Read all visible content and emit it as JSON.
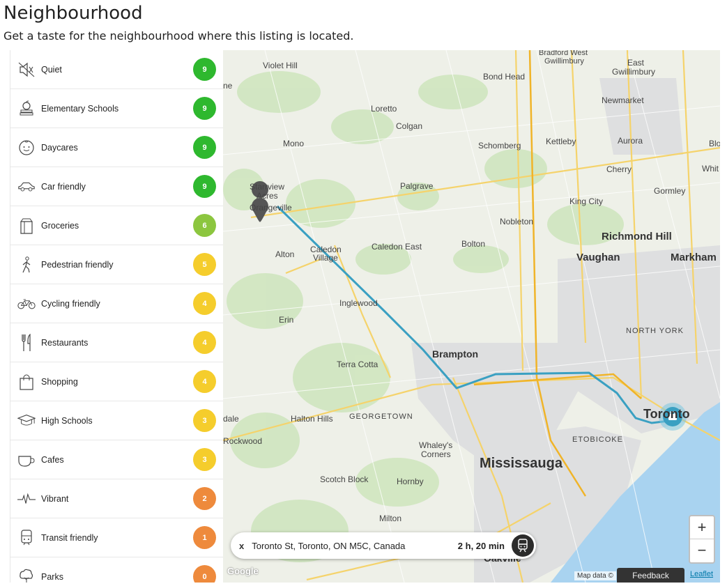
{
  "header": {
    "title": "Neighbourhood",
    "subtitle": "Get a taste for the neighbourhood where this listing is located."
  },
  "categories": [
    {
      "label": "Quiet",
      "score": "9",
      "icon": "speaker-muted-icon",
      "color": "#2eb82e"
    },
    {
      "label": "Elementary Schools",
      "score": "9",
      "icon": "apple-books-icon",
      "color": "#2eb82e"
    },
    {
      "label": "Daycares",
      "score": "9",
      "icon": "baby-face-icon",
      "color": "#2eb82e"
    },
    {
      "label": "Car friendly",
      "score": "9",
      "icon": "car-icon",
      "color": "#2eb82e"
    },
    {
      "label": "Groceries",
      "score": "6",
      "icon": "grocery-bag-icon",
      "color": "#8cc63f"
    },
    {
      "label": "Pedestrian friendly",
      "score": "5",
      "icon": "walking-person-icon",
      "color": "#f5cd2c"
    },
    {
      "label": "Cycling friendly",
      "score": "4",
      "icon": "bicycle-icon",
      "color": "#f5cd2c"
    },
    {
      "label": "Restaurants",
      "score": "4",
      "icon": "fork-knife-icon",
      "color": "#f5cd2c"
    },
    {
      "label": "Shopping",
      "score": "4",
      "icon": "shopping-bag-icon",
      "color": "#f5cd2c"
    },
    {
      "label": "High Schools",
      "score": "3",
      "icon": "graduation-cap-icon",
      "color": "#f5cd2c"
    },
    {
      "label": "Cafes",
      "score": "3",
      "icon": "coffee-cup-icon",
      "color": "#f5cd2c"
    },
    {
      "label": "Vibrant",
      "score": "2",
      "icon": "heartbeat-icon",
      "color": "#ee8a3c"
    },
    {
      "label": "Transit friendly",
      "score": "1",
      "icon": "train-icon",
      "color": "#ee8a3c"
    },
    {
      "label": "Parks",
      "score": "0",
      "icon": "tree-icon",
      "color": "#ee8a3c"
    }
  ],
  "map": {
    "places": {
      "violet_hill": "Violet Hill",
      "bradford": "Bradford West",
      "gwillimbury": "Gwillimbury",
      "bond_head": "Bond Head",
      "east_gw": "East",
      "east_gw2": "Gwillimbury",
      "newmarket": "Newmarket",
      "loretto": "Loretto",
      "colgan": "Colgan",
      "mono": "Mono",
      "schomberg": "Schomberg",
      "kettleby": "Kettleby",
      "aurora": "Aurora",
      "cherry": "Cherry",
      "bl": "Blo",
      "whit": "Whit",
      "starrview": "Starrview",
      "acres": "Acres",
      "orangeville": "Orangeville",
      "palgrave": "Palgrave",
      "gormley": "Gormley",
      "king_city": "King City",
      "nobleton": "Nobleton",
      "richmond_hill": "Richmond Hill",
      "alton": "Alton",
      "caledon": "Caledon",
      "village": "Village",
      "caledon_east": "Caledon East",
      "bolton": "Bolton",
      "vaughan": "Vaughan",
      "markham": "Markham",
      "inglewood": "Inglewood",
      "erin": "Erin",
      "north_york": "NORTH YORK",
      "brampton": "Brampton",
      "terra_cotta": "Terra Cotta",
      "toronto": "Toronto",
      "dale": "dale",
      "halton_hills": "Halton Hills",
      "georgetown": "GEORGETOWN",
      "etobicoke": "ETOBICOKE",
      "rockwood": "Rockwood",
      "whaleys": "Whaley's",
      "corners": "Corners",
      "mississauga": "Mississauga",
      "scotch_block": "Scotch Block",
      "hornby": "Hornby",
      "milton": "Milton",
      "oakville": "Oakville",
      "ne": "ne"
    },
    "route": {
      "destination": "Toronto St, Toronto, ON M5C, Canada",
      "duration": "2 h, 20 min",
      "close_label": "x",
      "mode_icon": "train-icon"
    },
    "zoom_in": "+",
    "zoom_out": "−",
    "attribution": "Map data ©",
    "feedback": "Feedback",
    "leaflet": "Leaflet",
    "google": "Google",
    "colors": {
      "route": "#3aa0c2",
      "road_major": "#f5d36b",
      "water": "#a9d3f0",
      "urban": "#dcdcdc",
      "green": "#cfe6bf"
    }
  }
}
